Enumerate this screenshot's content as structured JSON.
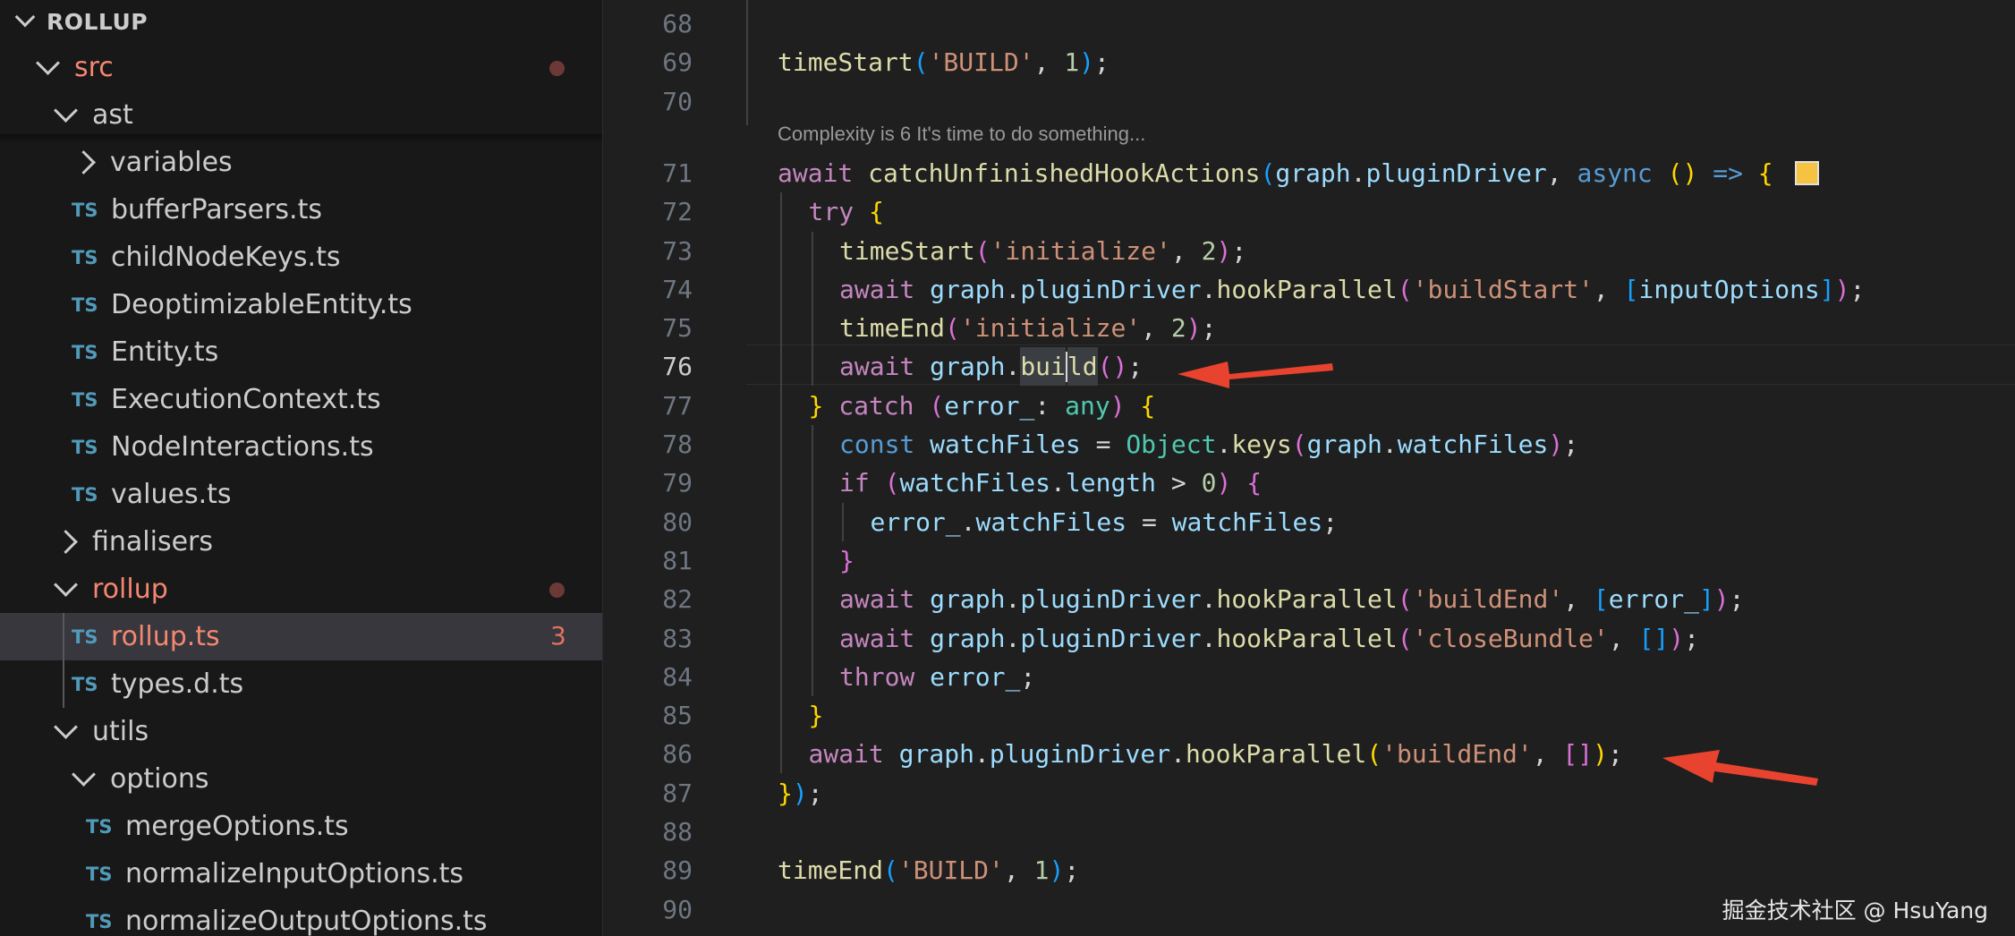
{
  "explorer": {
    "section_title": "ROLLUP",
    "tree": [
      {
        "label": "src",
        "type": "folder",
        "open": true,
        "depth": 1,
        "modified": true,
        "dot": true
      },
      {
        "label": "ast",
        "type": "folder",
        "open": true,
        "depth": 2
      },
      {
        "label": "variables",
        "type": "folder",
        "open": false,
        "depth": 3
      },
      {
        "label": "bufferParsers.ts",
        "type": "ts",
        "depth": 3
      },
      {
        "label": "childNodeKeys.ts",
        "type": "ts",
        "depth": 3
      },
      {
        "label": "DeoptimizableEntity.ts",
        "type": "ts",
        "depth": 3
      },
      {
        "label": "Entity.ts",
        "type": "ts",
        "depth": 3
      },
      {
        "label": "ExecutionContext.ts",
        "type": "ts",
        "depth": 3
      },
      {
        "label": "NodeInteractions.ts",
        "type": "ts",
        "depth": 3
      },
      {
        "label": "values.ts",
        "type": "ts",
        "depth": 3
      },
      {
        "label": "finalisers",
        "type": "folder",
        "open": false,
        "depth": 2
      },
      {
        "label": "rollup",
        "type": "folder",
        "open": true,
        "depth": 2,
        "modified": true,
        "dot": true
      },
      {
        "label": "rollup.ts",
        "type": "ts",
        "depth": 3,
        "modified": true,
        "selected": true,
        "count": "3"
      },
      {
        "label": "types.d.ts",
        "type": "ts",
        "depth": 3
      },
      {
        "label": "utils",
        "type": "folder",
        "open": true,
        "depth": 2
      },
      {
        "label": "options",
        "type": "folder",
        "open": true,
        "depth": 3
      },
      {
        "label": "mergeOptions.ts",
        "type": "ts",
        "depth": 4
      },
      {
        "label": "normalizeInputOptions.ts",
        "type": "ts",
        "depth": 4
      },
      {
        "label": "normalizeOutputOptions.ts",
        "type": "ts",
        "depth": 4
      }
    ],
    "ts_badge": "TS"
  },
  "editor": {
    "active_line": "76",
    "codelens": "Complexity is 6 It's time to do something...",
    "lines": [
      {
        "no": "68",
        "indent": 0,
        "tokens": []
      },
      {
        "no": "69",
        "indent": 0,
        "tokens": [
          [
            "timeStart",
            "f"
          ],
          [
            "(",
            "p3"
          ],
          [
            "'BUILD'",
            "s"
          ],
          [
            ", ",
            "txt"
          ],
          [
            "1",
            "n"
          ],
          [
            ")",
            "p3"
          ],
          [
            ";",
            "txt"
          ]
        ]
      },
      {
        "no": "70",
        "indent": 0,
        "tokens": []
      },
      {
        "no": "71",
        "indent": 0,
        "swatch": true,
        "tokens": [
          [
            "await ",
            "k"
          ],
          [
            "catchUnfinishedHookActions",
            "f"
          ],
          [
            "(",
            "p3"
          ],
          [
            "graph",
            "v"
          ],
          [
            ".",
            "txt"
          ],
          [
            "pluginDriver",
            "v"
          ],
          [
            ", ",
            "txt"
          ],
          [
            "async ",
            "b"
          ],
          [
            "() ",
            "p1"
          ],
          [
            "=> ",
            "b"
          ],
          [
            "{",
            "p1"
          ]
        ]
      },
      {
        "no": "72",
        "indent": 1,
        "tokens": [
          [
            "try ",
            "k"
          ],
          [
            "{",
            "p1"
          ]
        ]
      },
      {
        "no": "73",
        "indent": 2,
        "tokens": [
          [
            "timeStart",
            "f"
          ],
          [
            "(",
            "p2"
          ],
          [
            "'initialize'",
            "s"
          ],
          [
            ", ",
            "txt"
          ],
          [
            "2",
            "n"
          ],
          [
            ")",
            "p2"
          ],
          [
            ";",
            "txt"
          ]
        ]
      },
      {
        "no": "74",
        "indent": 2,
        "tokens": [
          [
            "await ",
            "k"
          ],
          [
            "graph",
            "v"
          ],
          [
            ".",
            "txt"
          ],
          [
            "pluginDriver",
            "v"
          ],
          [
            ".",
            "txt"
          ],
          [
            "hookParallel",
            "f"
          ],
          [
            "(",
            "p2"
          ],
          [
            "'buildStart'",
            "s"
          ],
          [
            ", ",
            "txt"
          ],
          [
            "[",
            "p3"
          ],
          [
            "inputOptions",
            "v"
          ],
          [
            "]",
            "p3"
          ],
          [
            ")",
            "p2"
          ],
          [
            ";",
            "txt"
          ]
        ]
      },
      {
        "no": "75",
        "indent": 2,
        "tokens": [
          [
            "timeEnd",
            "f"
          ],
          [
            "(",
            "p2"
          ],
          [
            "'initialize'",
            "s"
          ],
          [
            ", ",
            "txt"
          ],
          [
            "2",
            "n"
          ],
          [
            ")",
            "p2"
          ],
          [
            ";",
            "txt"
          ]
        ]
      },
      {
        "no": "76",
        "indent": 2,
        "cursor": true,
        "tokens": [
          [
            "await ",
            "k"
          ],
          [
            "graph",
            "v"
          ],
          [
            ".",
            "txt"
          ],
          [
            "bui",
            "f hl"
          ],
          [
            "|",
            "cursor"
          ],
          [
            "ld",
            "f hl"
          ],
          [
            "(",
            "p2"
          ],
          [
            ")",
            "p2"
          ],
          [
            ";",
            "txt"
          ]
        ]
      },
      {
        "no": "77",
        "indent": 1,
        "tokens": [
          [
            "}",
            "p1"
          ],
          [
            " catch ",
            "k"
          ],
          [
            "(",
            "p2"
          ],
          [
            "error_",
            "v"
          ],
          [
            ": ",
            "txt"
          ],
          [
            "any",
            "t"
          ],
          [
            ") ",
            "p2"
          ],
          [
            "{",
            "p1"
          ]
        ]
      },
      {
        "no": "78",
        "indent": 2,
        "tokens": [
          [
            "const ",
            "b"
          ],
          [
            "watchFiles",
            "v"
          ],
          [
            " = ",
            "txt"
          ],
          [
            "Object",
            "t"
          ],
          [
            ".",
            "txt"
          ],
          [
            "keys",
            "f"
          ],
          [
            "(",
            "p2"
          ],
          [
            "graph",
            "v"
          ],
          [
            ".",
            "txt"
          ],
          [
            "watchFiles",
            "v"
          ],
          [
            ")",
            "p2"
          ],
          [
            ";",
            "txt"
          ]
        ]
      },
      {
        "no": "79",
        "indent": 2,
        "tokens": [
          [
            "if ",
            "k"
          ],
          [
            "(",
            "p2"
          ],
          [
            "watchFiles",
            "v"
          ],
          [
            ".",
            "txt"
          ],
          [
            "length",
            "v"
          ],
          [
            " > ",
            "txt"
          ],
          [
            "0",
            "n"
          ],
          [
            ") ",
            "p2"
          ],
          [
            "{",
            "p2"
          ]
        ]
      },
      {
        "no": "80",
        "indent": 3,
        "tokens": [
          [
            "error_",
            "v"
          ],
          [
            ".",
            "txt"
          ],
          [
            "watchFiles",
            "v"
          ],
          [
            " = ",
            "txt"
          ],
          [
            "watchFiles",
            "v"
          ],
          [
            ";",
            "txt"
          ]
        ]
      },
      {
        "no": "81",
        "indent": 2,
        "tokens": [
          [
            "}",
            "p2"
          ]
        ]
      },
      {
        "no": "82",
        "indent": 2,
        "tokens": [
          [
            "await ",
            "k"
          ],
          [
            "graph",
            "v"
          ],
          [
            ".",
            "txt"
          ],
          [
            "pluginDriver",
            "v"
          ],
          [
            ".",
            "txt"
          ],
          [
            "hookParallel",
            "f"
          ],
          [
            "(",
            "p2"
          ],
          [
            "'buildEnd'",
            "s"
          ],
          [
            ", ",
            "txt"
          ],
          [
            "[",
            "p3"
          ],
          [
            "error_",
            "v"
          ],
          [
            "]",
            "p3"
          ],
          [
            ")",
            "p2"
          ],
          [
            ";",
            "txt"
          ]
        ]
      },
      {
        "no": "83",
        "indent": 2,
        "tokens": [
          [
            "await ",
            "k"
          ],
          [
            "graph",
            "v"
          ],
          [
            ".",
            "txt"
          ],
          [
            "pluginDriver",
            "v"
          ],
          [
            ".",
            "txt"
          ],
          [
            "hookParallel",
            "f"
          ],
          [
            "(",
            "p2"
          ],
          [
            "'closeBundle'",
            "s"
          ],
          [
            ", ",
            "txt"
          ],
          [
            "[]",
            "p3"
          ],
          [
            ")",
            "p2"
          ],
          [
            ";",
            "txt"
          ]
        ]
      },
      {
        "no": "84",
        "indent": 2,
        "tokens": [
          [
            "throw ",
            "k"
          ],
          [
            "error_",
            "v"
          ],
          [
            ";",
            "txt"
          ]
        ]
      },
      {
        "no": "85",
        "indent": 1,
        "tokens": [
          [
            "}",
            "p1"
          ]
        ]
      },
      {
        "no": "86",
        "indent": 1,
        "tokens": [
          [
            "await ",
            "k"
          ],
          [
            "graph",
            "v"
          ],
          [
            ".",
            "txt"
          ],
          [
            "pluginDriver",
            "v"
          ],
          [
            ".",
            "txt"
          ],
          [
            "hookParallel",
            "f"
          ],
          [
            "(",
            "p1"
          ],
          [
            "'buildEnd'",
            "s"
          ],
          [
            ", ",
            "txt"
          ],
          [
            "[]",
            "p2"
          ],
          [
            ")",
            "p1"
          ],
          [
            ";",
            "txt"
          ]
        ]
      },
      {
        "no": "87",
        "indent": 0,
        "tokens": [
          [
            "}",
            "p1"
          ],
          [
            ")",
            "p3"
          ],
          [
            ";",
            "txt"
          ]
        ]
      },
      {
        "no": "88",
        "indent": 0,
        "tokens": []
      },
      {
        "no": "89",
        "indent": 0,
        "tokens": [
          [
            "timeEnd",
            "f"
          ],
          [
            "(",
            "p3"
          ],
          [
            "'BUILD'",
            "s"
          ],
          [
            ", ",
            "txt"
          ],
          [
            "1",
            "n"
          ],
          [
            ")",
            "p3"
          ],
          [
            ";",
            "txt"
          ]
        ]
      },
      {
        "no": "90",
        "indent": 0,
        "tokens": []
      }
    ]
  },
  "icons": [
    "chevron-down-icon",
    "chevron-right-icon",
    "typescript-file-icon",
    "modified-dot-icon",
    "color-swatch-icon",
    "red-arrow-annotation"
  ],
  "colors": {
    "sidebar_bg": "#181818",
    "editor_bg": "#1f1f1f",
    "modified": "#f48771",
    "ts_icon": "#519aba",
    "arrow": "#e8432f",
    "swatch": "#f5c242"
  },
  "watermark": "掘金技术社区 @ HsuYang"
}
